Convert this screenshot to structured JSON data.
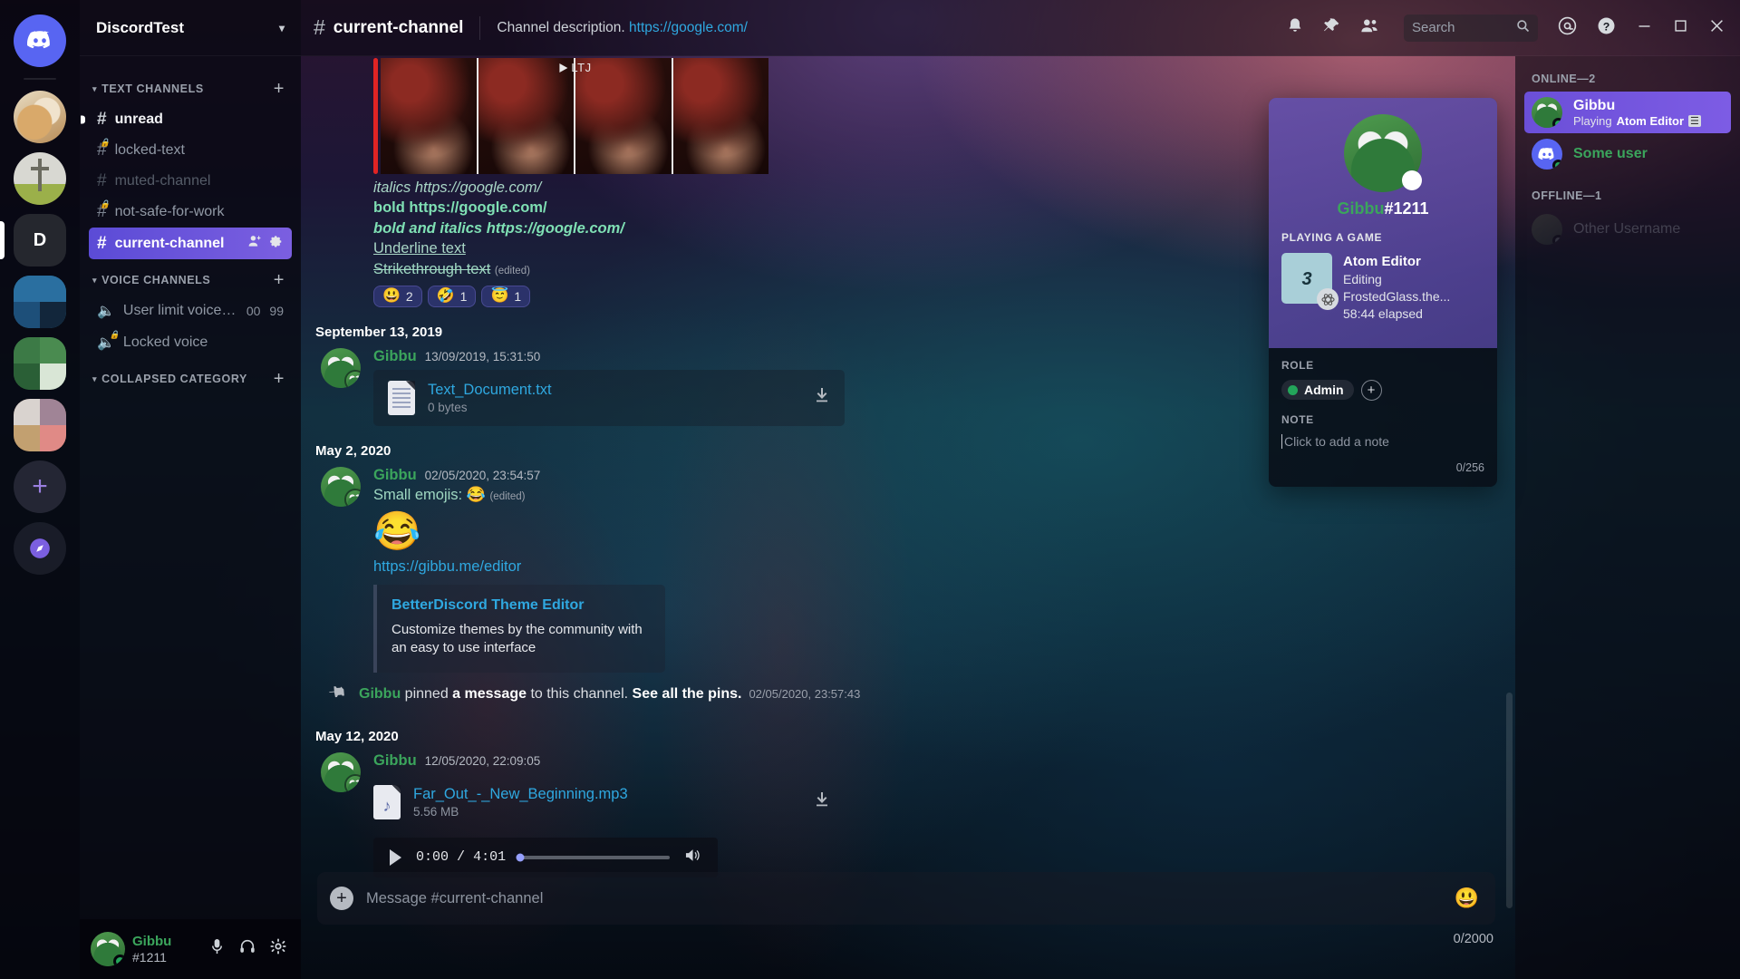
{
  "server_rail": {
    "items": [
      {
        "name": "home-discord",
        "kind": "home",
        "label": "Discord Home"
      },
      {
        "name": "server-doge",
        "kind": "doge",
        "label": "Doge Server"
      },
      {
        "name": "server-cross",
        "kind": "cross",
        "label": "Cross Server"
      },
      {
        "name": "server-d",
        "kind": "letter",
        "label": "D",
        "selected": true
      },
      {
        "name": "server-blue-grid",
        "kind": "grid-blue",
        "label": "Blue Folder"
      },
      {
        "name": "server-green-grid",
        "kind": "grid-green",
        "label": "Green Folder"
      },
      {
        "name": "server-brown-grid",
        "kind": "grid-brown",
        "label": "Brown Folder"
      },
      {
        "name": "add-server",
        "kind": "add",
        "label": "+"
      },
      {
        "name": "explore-servers",
        "kind": "explore",
        "label": "Explore"
      }
    ]
  },
  "sidebar": {
    "guild_name": "DiscordTest",
    "guild_chevron": "⌄",
    "categories": [
      {
        "label": "TEXT CHANNELS",
        "add_label": "+",
        "chevron": "⌄",
        "channels": [
          {
            "name": "unread",
            "hash": "#",
            "state": "unread",
            "locked": false
          },
          {
            "name": "locked-text",
            "hash": "#",
            "state": "normal",
            "locked": true
          },
          {
            "name": "muted-channel",
            "hash": "#",
            "state": "muted",
            "locked": false
          },
          {
            "name": "not-safe-for-work",
            "hash": "#",
            "state": "normal",
            "locked": true
          },
          {
            "name": "current-channel",
            "hash": "#",
            "state": "active",
            "locked": false,
            "actions": [
              "invite-people",
              "channel-settings"
            ]
          }
        ]
      },
      {
        "label": "VOICE CHANNELS",
        "add_label": "+",
        "chevron": "⌄",
        "channels": [
          {
            "name": "User limit voice c...",
            "kind": "voice",
            "locked": false,
            "count_current": "00",
            "count_limit": "99"
          },
          {
            "name": "Locked voice",
            "kind": "voice",
            "locked": true
          }
        ]
      },
      {
        "label": "COLLAPSED CATEGORY",
        "add_label": "+",
        "chevron": "⌄",
        "channels": []
      }
    ],
    "user_panel": {
      "username": "Gibbu",
      "tag": "#1211",
      "icons": [
        "microphone-icon",
        "headphones-icon",
        "gear-icon"
      ]
    }
  },
  "topbar": {
    "hash": "#",
    "channel_name": "current-channel",
    "description_text": "Channel description.",
    "description_link": "https://google.com/",
    "icons": [
      "bell-icon",
      "pin-icon",
      "members-icon",
      "inbox-icon",
      "help-icon"
    ],
    "search_placeholder": "Search",
    "window_controls": [
      "minimize",
      "maximize",
      "close"
    ]
  },
  "messages": {
    "first_message": {
      "format_lines": [
        {
          "style": "italic",
          "text": "italics ",
          "link": "https://google.com/"
        },
        {
          "style": "bold",
          "text": "bold ",
          "link": "https://google.com/"
        },
        {
          "style": "bold-italic",
          "text": "bold and italics ",
          "link": "https://google.com/"
        },
        {
          "style": "underline",
          "text": "Underline text",
          "link": ""
        },
        {
          "style": "strikethrough",
          "text": "Strikethrough text",
          "link": "",
          "edited": "(edited)"
        }
      ],
      "gif_overlay_label": "LTJ",
      "reactions": [
        {
          "emoji": "😃",
          "count": "2",
          "name": "smiley-reaction"
        },
        {
          "emoji": "🤣",
          "count": "1",
          "name": "rofl-reaction"
        },
        {
          "emoji": "😇",
          "count": "1",
          "name": "innocent-reaction"
        }
      ]
    },
    "groups": [
      {
        "divider": "September 13, 2019",
        "author": "Gibbu",
        "timestamp": "13/09/2019, 15:31:50",
        "attachment": {
          "filename": "Text_Document.txt",
          "filesize": "0 bytes",
          "icon": "text-file-icon"
        }
      },
      {
        "divider": "May 2, 2020",
        "author": "Gibbu",
        "timestamp": "02/05/2020, 23:54:57",
        "text": "Small emojis:",
        "inline_emoji": "😂",
        "edited": "(edited)",
        "big_emoji": "😂",
        "link": "https://gibbu.me/editor",
        "embed": {
          "title": "BetterDiscord Theme Editor",
          "description": "Customize themes by the community with an easy to use interface"
        }
      }
    ],
    "pinned_notice": {
      "author": "Gibbu",
      "action_before": " pinned ",
      "action_bold": "a message",
      "action_after": " to this channel. ",
      "see_pins": "See all the pins.",
      "timestamp": "02/05/2020, 23:57:43"
    },
    "last_group": {
      "divider": "May 12, 2020",
      "author": "Gibbu",
      "timestamp": "12/05/2020, 22:09:05",
      "attachment": {
        "filename": "Far_Out_-_New_Beginning.mp3",
        "filesize": "5.56 MB",
        "icon": "audio-file-icon"
      },
      "audio": {
        "current_time": "0:00",
        "separator": "/",
        "duration": "4:01",
        "progress_percent": 1
      }
    }
  },
  "composer": {
    "placeholder": "Message #current-channel",
    "add_label": "+",
    "emoji_icon": "😃",
    "char_count": "0/2000"
  },
  "member_list": {
    "sections": [
      {
        "label": "ONLINE—2",
        "members": [
          {
            "name": "Gibbu",
            "selected": true,
            "status": "online",
            "activity_prefix": "Playing ",
            "activity_name": "Atom Editor",
            "activity_icon": "☰",
            "avatar": "pepe"
          },
          {
            "name": "Some user",
            "selected": false,
            "status": "online",
            "avatar": "discord"
          }
        ]
      },
      {
        "label": "OFFLINE—1",
        "members": [
          {
            "name": "Other Username",
            "selected": false,
            "status": "offline",
            "avatar": "ghost"
          }
        ]
      }
    ]
  },
  "profile_popout": {
    "username": "Gibbu",
    "discriminator": "#1211",
    "activity_label": "PLAYING A GAME",
    "game_name": "Atom Editor",
    "game_detail": "Editing FrostedGlass.the...",
    "game_elapsed": "58:44 elapsed",
    "game_icon_glyph": "☰",
    "role_label": "ROLE",
    "roles": [
      {
        "name": "Admin",
        "color": "#23a55a"
      }
    ],
    "role_add_label": "+",
    "note_label": "NOTE",
    "note_placeholder": "Click to add a note",
    "note_count": "0/256"
  },
  "colors": {
    "accent": "#5865f2",
    "active_channel": "#7b5fe0",
    "online": "#23a55a",
    "link": "#2fa8e0",
    "username_green": "#3ba55c",
    "quote_bar": "#e02424"
  }
}
